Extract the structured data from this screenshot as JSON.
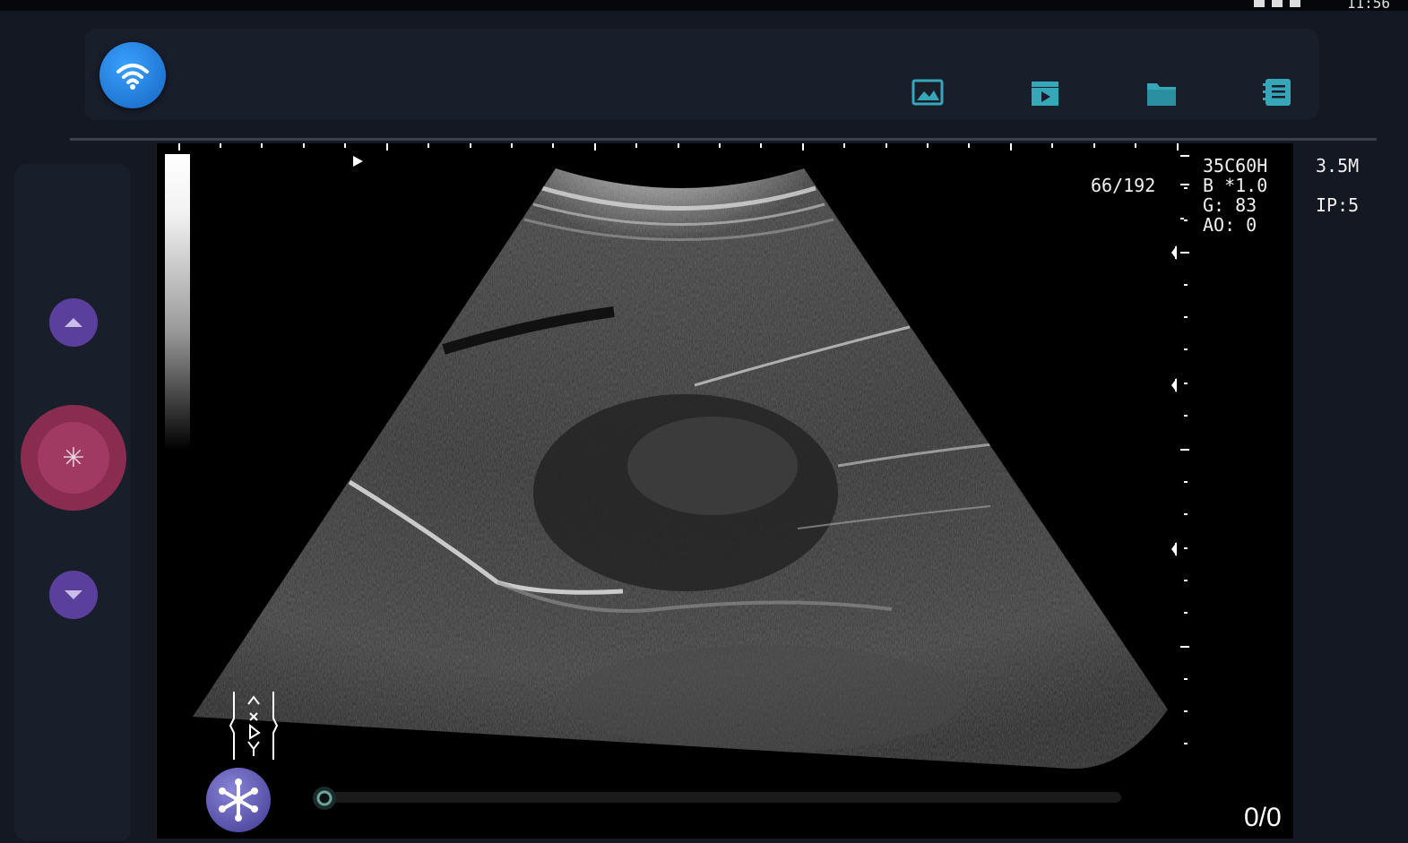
{
  "status_bar": {
    "time": "11:56"
  },
  "toolbar": {
    "wifi": {
      "icon": "wifi-icon"
    },
    "buttons": [
      {
        "name": "image-gallery",
        "icon": "image-icon"
      },
      {
        "name": "video-clips",
        "icon": "video-icon"
      },
      {
        "name": "folder",
        "icon": "folder-icon"
      },
      {
        "name": "report",
        "icon": "report-icon"
      }
    ]
  },
  "sidebar": {
    "up_icon": "triangle-up-icon",
    "freeze_icon": "asterisk-icon",
    "down_icon": "triangle-down-icon"
  },
  "image_info": {
    "depth_counter": "66/192",
    "probe": "35C60H",
    "frequency": "3.5M",
    "b_zoom": "B *1.0",
    "gain": "G: 83",
    "ao": "AO: 0",
    "ip": "IP:5"
  },
  "playback": {
    "frame_counter": "0/0",
    "freeze_icon": "snowflake-icon",
    "slider_position": 0
  },
  "colors": {
    "background": "#141823",
    "panel": "#191e2b",
    "accent_purple": "#5a3f9c",
    "freeze_pink": "#a13a63",
    "wifi_blue": "#1e88e5",
    "icon_teal": "#36a7b8"
  }
}
